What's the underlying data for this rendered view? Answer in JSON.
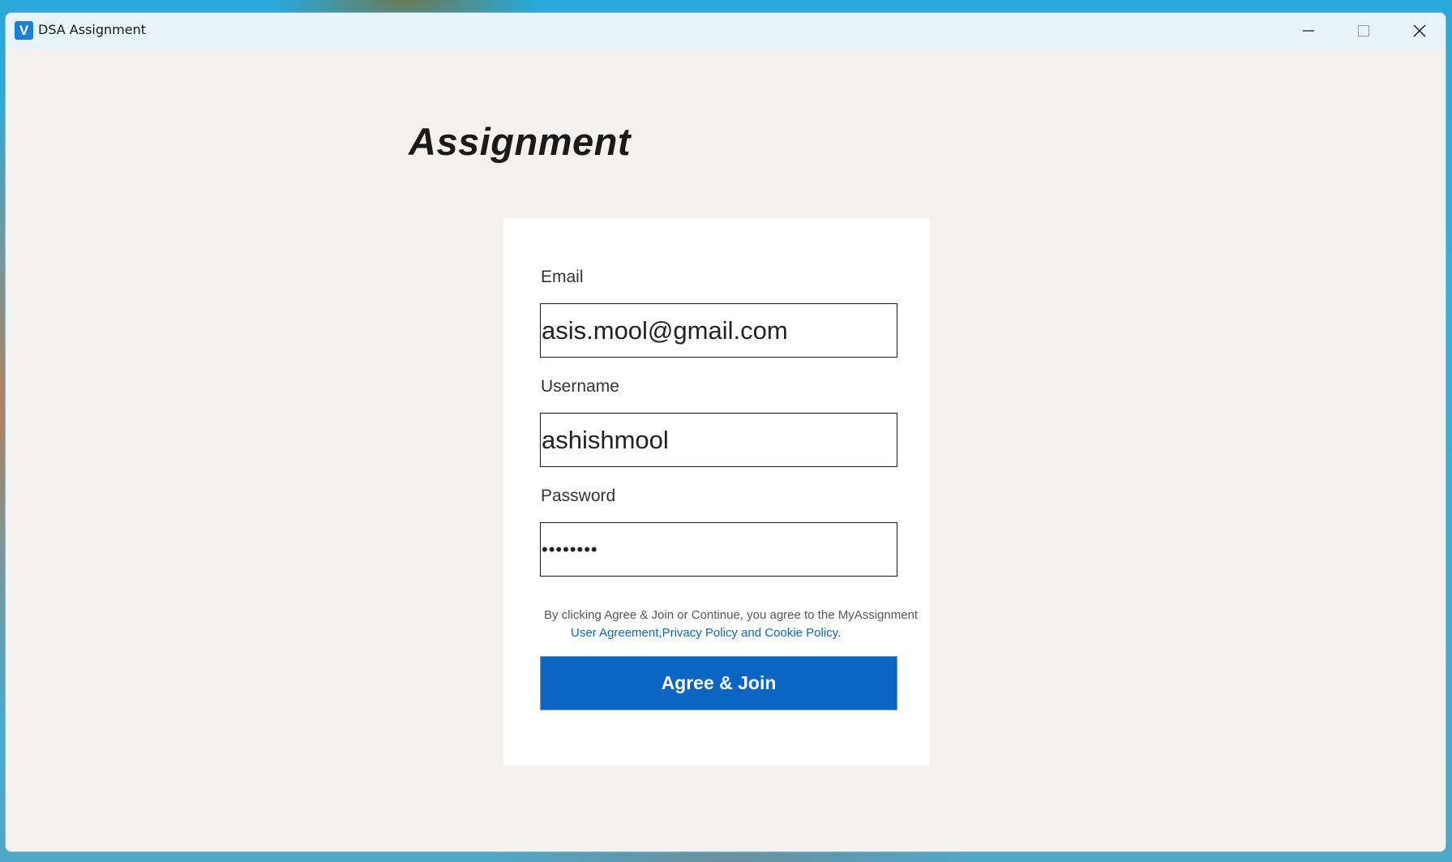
{
  "window": {
    "title": "DSA Assignment",
    "app_icon_letter": "V",
    "controls": [
      "minimize-icon",
      "maximize-icon",
      "close-icon"
    ]
  },
  "page": {
    "heading": "Assignment"
  },
  "form": {
    "email": {
      "label": "Email",
      "value": "asis.mool@gmail.com"
    },
    "username": {
      "label": "Username",
      "value": "ashishmool"
    },
    "password": {
      "label": "Password",
      "value": "••••••••"
    },
    "agreement": {
      "text": "By clicking Agree & Join or Continue, you agree to the MyAssignment",
      "link_user_agreement": "User Agreement",
      "separator": ",",
      "link_privacy": "Privacy Policy",
      "and_text": "and",
      "link_cookie": "Cookie Policy",
      "period": "."
    },
    "submit_label": "Agree & Join"
  },
  "colors": {
    "accent": "#0a66c2",
    "window_bg": "#f3f2f1",
    "titlebar_bg": "#e6f3f8",
    "card_bg": "#ffffff"
  }
}
